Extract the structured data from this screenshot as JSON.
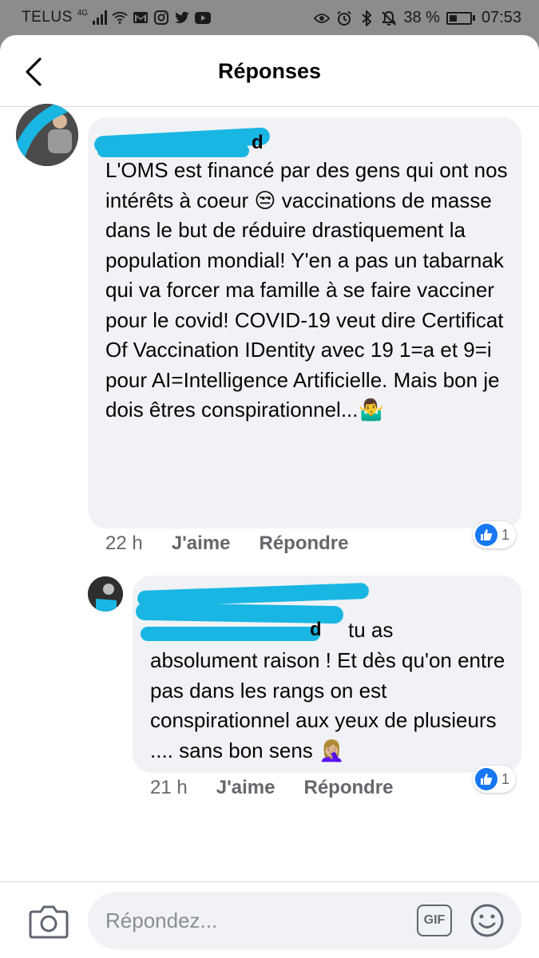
{
  "status_bar": {
    "carrier": "TELUS",
    "network": "4G",
    "battery": "38 %",
    "battery_level": 0.38,
    "time": "07:53"
  },
  "header": {
    "title": "Réponses",
    "back_icon": "back-arrow-icon"
  },
  "comments": [
    {
      "author": "d",
      "text": "L'OMS est financé par des gens qui ont nos intérêts à coeur 😒 vaccinations de masse dans le but de réduire drastiquement la population mondial! Y'en a pas un tabarnak qui va forcer ma famille à se faire vacciner pour le covid! COVID-19 veut dire Certificat Of Vaccination IDentity avec 19 1=a et 9=i pour AI=Intelligence Artificielle. Mais bon je dois êtres conspirationnel...🤷‍♂️",
      "time": "22 h",
      "like_label": "J'aime",
      "reply_label": "Répondre",
      "reaction_count": "1"
    },
    {
      "author": "d",
      "text_first": "tu as",
      "text_rest": "absolument raison ! Et dès qu'on entre pas dans les rangs on est conspirationnel aux yeux de plusieurs .... sans bon sens 🤦🏼‍♀️",
      "time": "21 h",
      "like_label": "J'aime",
      "reply_label": "Répondre",
      "reaction_count": "1"
    }
  ],
  "composer": {
    "placeholder": "Répondez...",
    "gif_label": "GIF",
    "camera_icon": "camera-icon",
    "emoji_icon": "smiley-icon"
  },
  "colors": {
    "accent": "#1877f2",
    "bubble": "#f0f2f5",
    "muted_text": "#65676b",
    "redaction": "#19b6e3"
  }
}
